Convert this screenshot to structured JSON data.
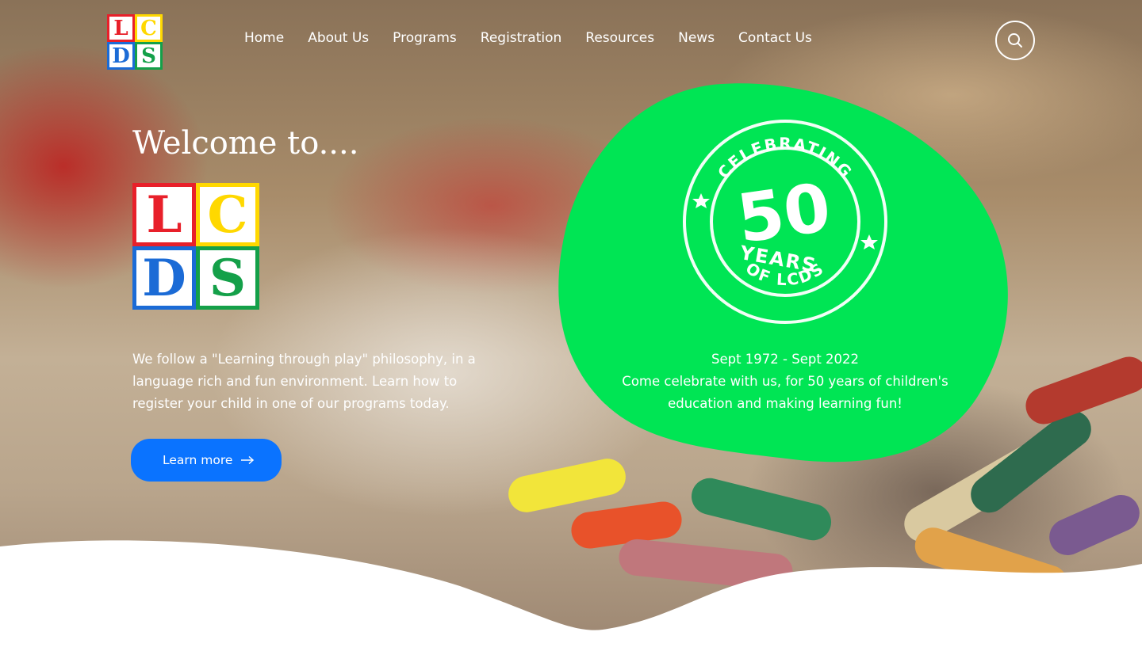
{
  "logo": {
    "letters": [
      "L",
      "C",
      "D",
      "S"
    ]
  },
  "nav": {
    "items": [
      "Home",
      "About Us",
      "Programs",
      "Registration",
      "Resources",
      "News",
      "Contact Us"
    ]
  },
  "search": {
    "icon": "search-icon"
  },
  "hero": {
    "welcome": "Welcome to....",
    "intro": "We follow a \"Learning through play\" philosophy, in a language rich and fun environment. Learn how to register your child in one of our programs today.",
    "cta_label": "Learn more",
    "cta_icon": "arrow-right-icon"
  },
  "anniversary": {
    "badge_top": "CELEBRATING",
    "badge_number": "50",
    "badge_years": "YEARS",
    "badge_bottom": "OF LCDS",
    "dates": "Sept 1972 - Sept 2022",
    "message": "Come celebrate with us, for 50 years of children's education and making learning fun!"
  },
  "colors": {
    "accent_green": "#00e554",
    "button_blue": "#0a73ff",
    "logo_red": "#e8202a",
    "logo_yellow": "#ffd800",
    "logo_blue": "#1b6bd6",
    "logo_green": "#14a049"
  }
}
